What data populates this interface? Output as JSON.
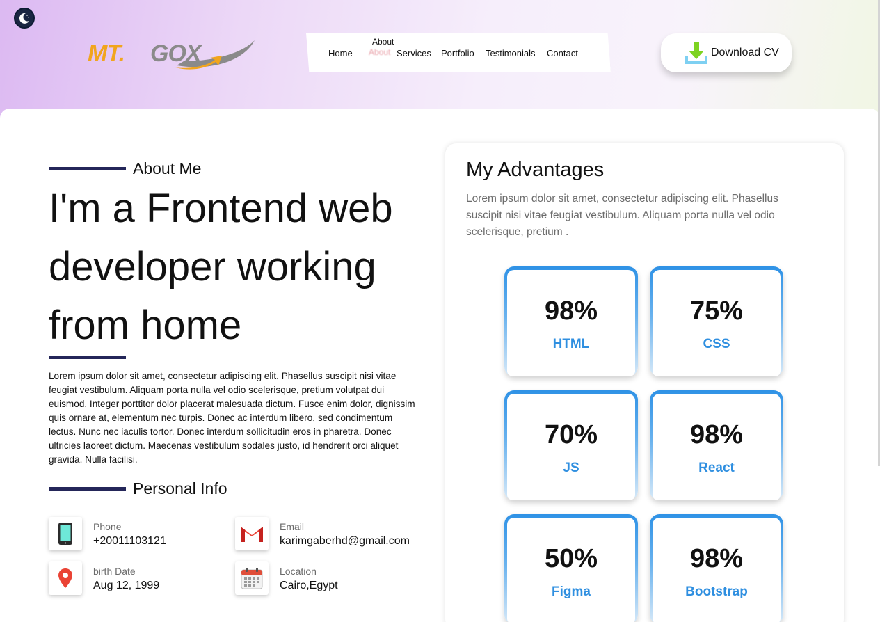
{
  "header": {
    "theme_toggle_icon": "moon-icon",
    "logo_text": "MT.GOX",
    "nav": {
      "home": "Home",
      "about": "About",
      "services": "Services",
      "portfolio": "Portfolio",
      "testimonials": "Testimonials",
      "contact": "Contact"
    },
    "download_button": {
      "label": "Download CV",
      "icon": "download-icon"
    }
  },
  "about": {
    "section_label": "About Me",
    "headline": "I'm a Frontend web developer working from home",
    "bio": "Lorem ipsum dolor sit amet, consectetur adipiscing elit. Phasellus suscipit nisi vitae feugiat vestibulum. Aliquam porta nulla vel odio scelerisque, pretium volutpat dui euismod. Integer porttitor dolor placerat malesuada dictum. Fusce enim dolor, dignissim quis ornare at, elementum nec turpis. Donec ac interdum libero, sed condimentum lectus. Nunc nec iaculis tortor. Donec interdum sollicitudin eros in pharetra. Donec ultricies laoreet dictum. Maecenas vestibulum sodales justo, id hendrerit orci aliquet gravida. Nulla facilisi."
  },
  "personal_info": {
    "section_label": "Personal Info",
    "items": [
      {
        "label": "Phone",
        "value": "+20011103121",
        "icon": "phone-icon"
      },
      {
        "label": "Email",
        "value": "karimgaberhd@gmail.com",
        "icon": "gmail-icon"
      },
      {
        "label": "birth Date",
        "value": "Aug 12, 1999",
        "icon": "map-pin-icon"
      },
      {
        "label": "Location",
        "value": "Cairo,Egypt",
        "icon": "calendar-icon"
      }
    ]
  },
  "advantages": {
    "title": "My Advantages",
    "description": "Lorem ipsum dolor sit amet, consectetur adipiscing elit. Phasellus suscipit nisi vitae feugiat vestibulum. Aliquam porta nulla vel odio scelerisque, pretium .",
    "skills": [
      {
        "percent": "98%",
        "name": "HTML"
      },
      {
        "percent": "75%",
        "name": "CSS"
      },
      {
        "percent": "70%",
        "name": "JS"
      },
      {
        "percent": "98%",
        "name": "React"
      },
      {
        "percent": "50%",
        "name": "Figma"
      },
      {
        "percent": "98%",
        "name": "Bootstrap"
      }
    ]
  },
  "colors": {
    "accent_bar": "#242659",
    "skill_blue": "#2f8fe0",
    "download_green": "#7ed321"
  }
}
